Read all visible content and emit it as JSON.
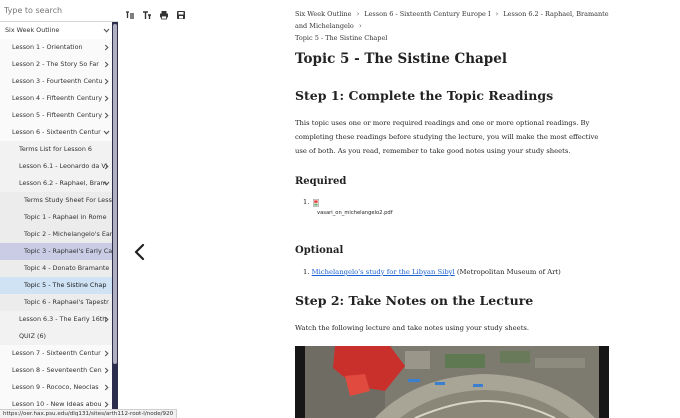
{
  "search": {
    "placeholder": "Type to search"
  },
  "sidebar": {
    "items": [
      {
        "label": "Six Week Outline",
        "chevron": "down",
        "level": 0,
        "state": ""
      },
      {
        "label": "Lesson 1 - Orientation",
        "chevron": "right",
        "level": 1,
        "state": ""
      },
      {
        "label": "Lesson 2 - The Story So Far",
        "chevron": "right",
        "level": 1,
        "state": ""
      },
      {
        "label": "Lesson 3 - Fourteenth Centu",
        "chevron": "right",
        "level": 1,
        "state": ""
      },
      {
        "label": "Lesson 4 - Fifteenth Century",
        "chevron": "right",
        "level": 1,
        "state": ""
      },
      {
        "label": "Lesson 5 - Fifteenth Century",
        "chevron": "right",
        "level": 1,
        "state": ""
      },
      {
        "label": "Lesson 6 - Sixteenth Centur",
        "chevron": "down",
        "level": 1,
        "state": ""
      },
      {
        "label": "Terms List for Lesson 6",
        "chevron": "",
        "level": 2,
        "state": ""
      },
      {
        "label": "Lesson 6.1 - Leonardo da Vi",
        "chevron": "right",
        "level": 2,
        "state": ""
      },
      {
        "label": "Lesson 6.2 - Raphael, Bram",
        "chevron": "down",
        "level": 2,
        "state": ""
      },
      {
        "label": "Terms Study Sheet For Less",
        "chevron": "",
        "level": 3,
        "state": ""
      },
      {
        "label": "Topic 1 - Raphael in Rome",
        "chevron": "",
        "level": 3,
        "state": ""
      },
      {
        "label": "Topic 2 - Michelangelo's Ear",
        "chevron": "",
        "level": 3,
        "state": ""
      },
      {
        "label": "Topic 3 - Raphael's Early Ca",
        "chevron": "",
        "level": 3,
        "state": "highlight"
      },
      {
        "label": "Topic 4 - Donato Bramante",
        "chevron": "",
        "level": 3,
        "state": ""
      },
      {
        "label": "Topic 5 - The Sistine Chap",
        "chevron": "",
        "level": 3,
        "state": "active"
      },
      {
        "label": "Topic 6 - Raphael's Tapestr",
        "chevron": "",
        "level": 3,
        "state": ""
      },
      {
        "label": "Lesson 6.3 - The Early 16th",
        "chevron": "right",
        "level": 2,
        "state": ""
      },
      {
        "label": "QUIZ (6)",
        "chevron": "",
        "level": 2,
        "state": ""
      },
      {
        "label": "Lesson 7 - Sixteenth Centur",
        "chevron": "right",
        "level": 1,
        "state": ""
      },
      {
        "label": "Lesson 8 - Seventeenth Cen",
        "chevron": "right",
        "level": 1,
        "state": ""
      },
      {
        "label": "Lesson 9 - Rococo, Neoclas",
        "chevron": "right",
        "level": 1,
        "state": ""
      },
      {
        "label": "Lesson 10 - New Ideas abou",
        "chevron": "right",
        "level": 1,
        "state": ""
      }
    ]
  },
  "toolbar": {
    "icons": [
      "text-format-icon",
      "font-size-icon",
      "print-icon",
      "save-icon"
    ]
  },
  "breadcrumb": {
    "items": [
      "Six Week Outline",
      "Lesson 6 - Sixteenth Century Europe I",
      "Lesson 6.2 - Raphael, Bramante and Michelangelo",
      "Topic 5 - The Sistine Chapel"
    ]
  },
  "page": {
    "title": "Topic 5 - The Sistine Chapel",
    "step1_title": "Step 1: Complete the Topic Readings",
    "step1_text": "This topic uses one or more required readings and one or more optional readings. By completing these readings before studying the lecture, you will make the most effective use of both. As you read, remember to take good notes using your study sheets.",
    "required_heading": "Required",
    "required_num": "1.",
    "required_file": "vasari_on_michelangelo2.pdf",
    "optional_heading": "Optional",
    "optional_num": "1.",
    "optional_link": "Michelangelo's study for the Libyan Sibyl",
    "optional_note": " (Metropolitan Museum of Art)",
    "step2_title": "Step 2: Take Notes on the Lecture",
    "step2_text": "Watch the following lecture and take notes using your study sheets."
  },
  "status": {
    "url": "https://oer.hax.psu.edu/dlq131/sites/arth112-root-l/node/920"
  }
}
